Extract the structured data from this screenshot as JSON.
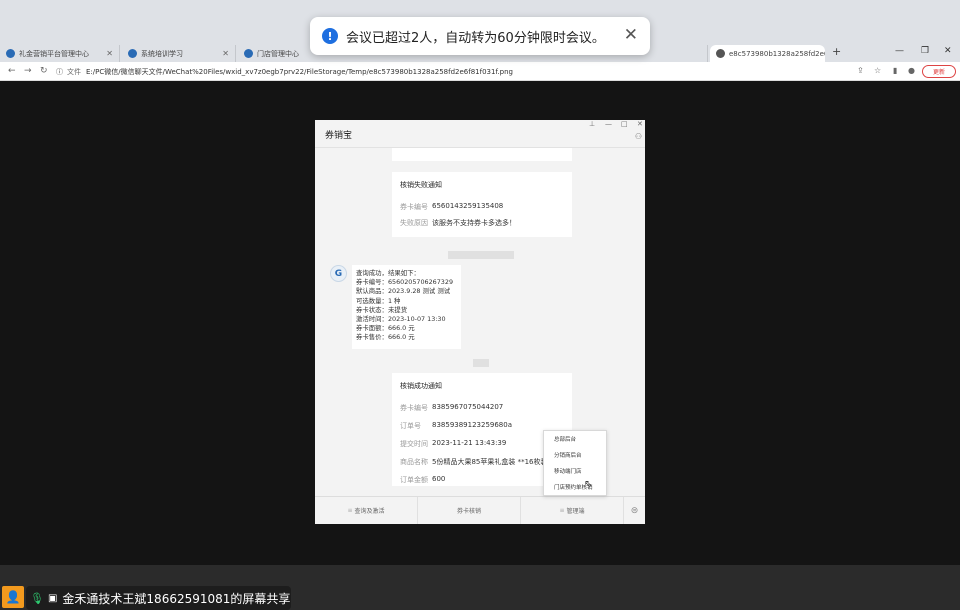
{
  "toast": {
    "message": "会议已超过2人，自动转为60分钟限时会议。",
    "close_glyph": "✕"
  },
  "browser": {
    "tabs": [
      {
        "label": "礼金营销平台管理中心",
        "color": "#2a6bb5"
      },
      {
        "label": "系统培训学习",
        "color": "#2a6bb5"
      },
      {
        "label": "门店管理中心",
        "color": "#2a6bb5"
      },
      {
        "label": "e8c573980b1328a258fd2e6f81f...",
        "color": "#555555"
      }
    ],
    "url_label": "文件",
    "url": "E:/PC微信/微信聊天文件/WeChat%20Files/wxid_xv7z0egb7prv22/FileStorage/Temp/e8c573980b1328a258fd2e6f81f031f.png",
    "update_label": "更新"
  },
  "app": {
    "title": "券销宝",
    "fail_card": {
      "title": "核销失败通知",
      "rows": [
        {
          "k": "券卡编号",
          "v": "6560143259135408"
        },
        {
          "k": "失败原因",
          "v": "该服务不支持券卡多选多！"
        }
      ]
    },
    "bubble_text": "查询成功，结果如下：\n券卡编号：6560205706267329\n默认商品：2023.9.28 测试 测试\n可选数量：1 种\n券卡状态：未提货\n激活时间：2023-10-07 13:30\n券卡面额：666.0 元\n券卡售价：666.0 元",
    "success_card": {
      "title": "核销成功通知",
      "rows": [
        {
          "k": "券卡编号",
          "v": "8385967075044207"
        },
        {
          "k": "订单号",
          "v": "83859389123259680a"
        },
        {
          "k": "提交时间",
          "v": "2023-11-21 13:43:39"
        },
        {
          "k": "商品名称",
          "v": "5份精品大果85苹果礼盒装 **16枚装"
        },
        {
          "k": "订单金额",
          "v": "600"
        }
      ]
    },
    "menu": {
      "items": [
        "查询及激活",
        "券卡核销",
        "管理端"
      ]
    },
    "popup_items": [
      "总部后台",
      "分销商后台",
      "移动端门店",
      "门店预约单核销"
    ]
  },
  "footer": {
    "share_text": "金禾通技术王斌18662591081的屏幕共享"
  }
}
